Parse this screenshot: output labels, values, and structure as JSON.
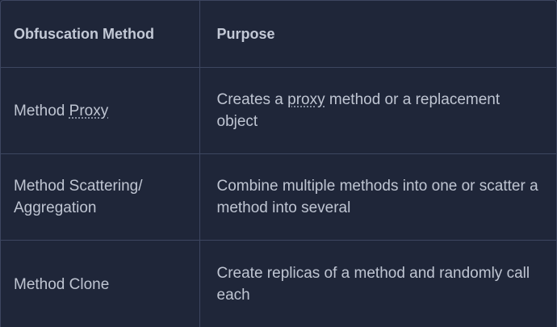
{
  "table": {
    "headers": [
      "Obfuscation Method",
      "Purpose"
    ],
    "rows": [
      {
        "method_prefix": "Method ",
        "method_abbr": "Proxy",
        "purpose_prefix": "Creates a ",
        "purpose_abbr": "proxy",
        "purpose_suffix": " method or a replacement object"
      },
      {
        "method": "Method Scattering/ Aggregation",
        "purpose": "Combine multiple methods into one or scatter a method into several"
      },
      {
        "method": "Method Clone",
        "purpose": "Create replicas of a method and randomly call each"
      }
    ]
  }
}
